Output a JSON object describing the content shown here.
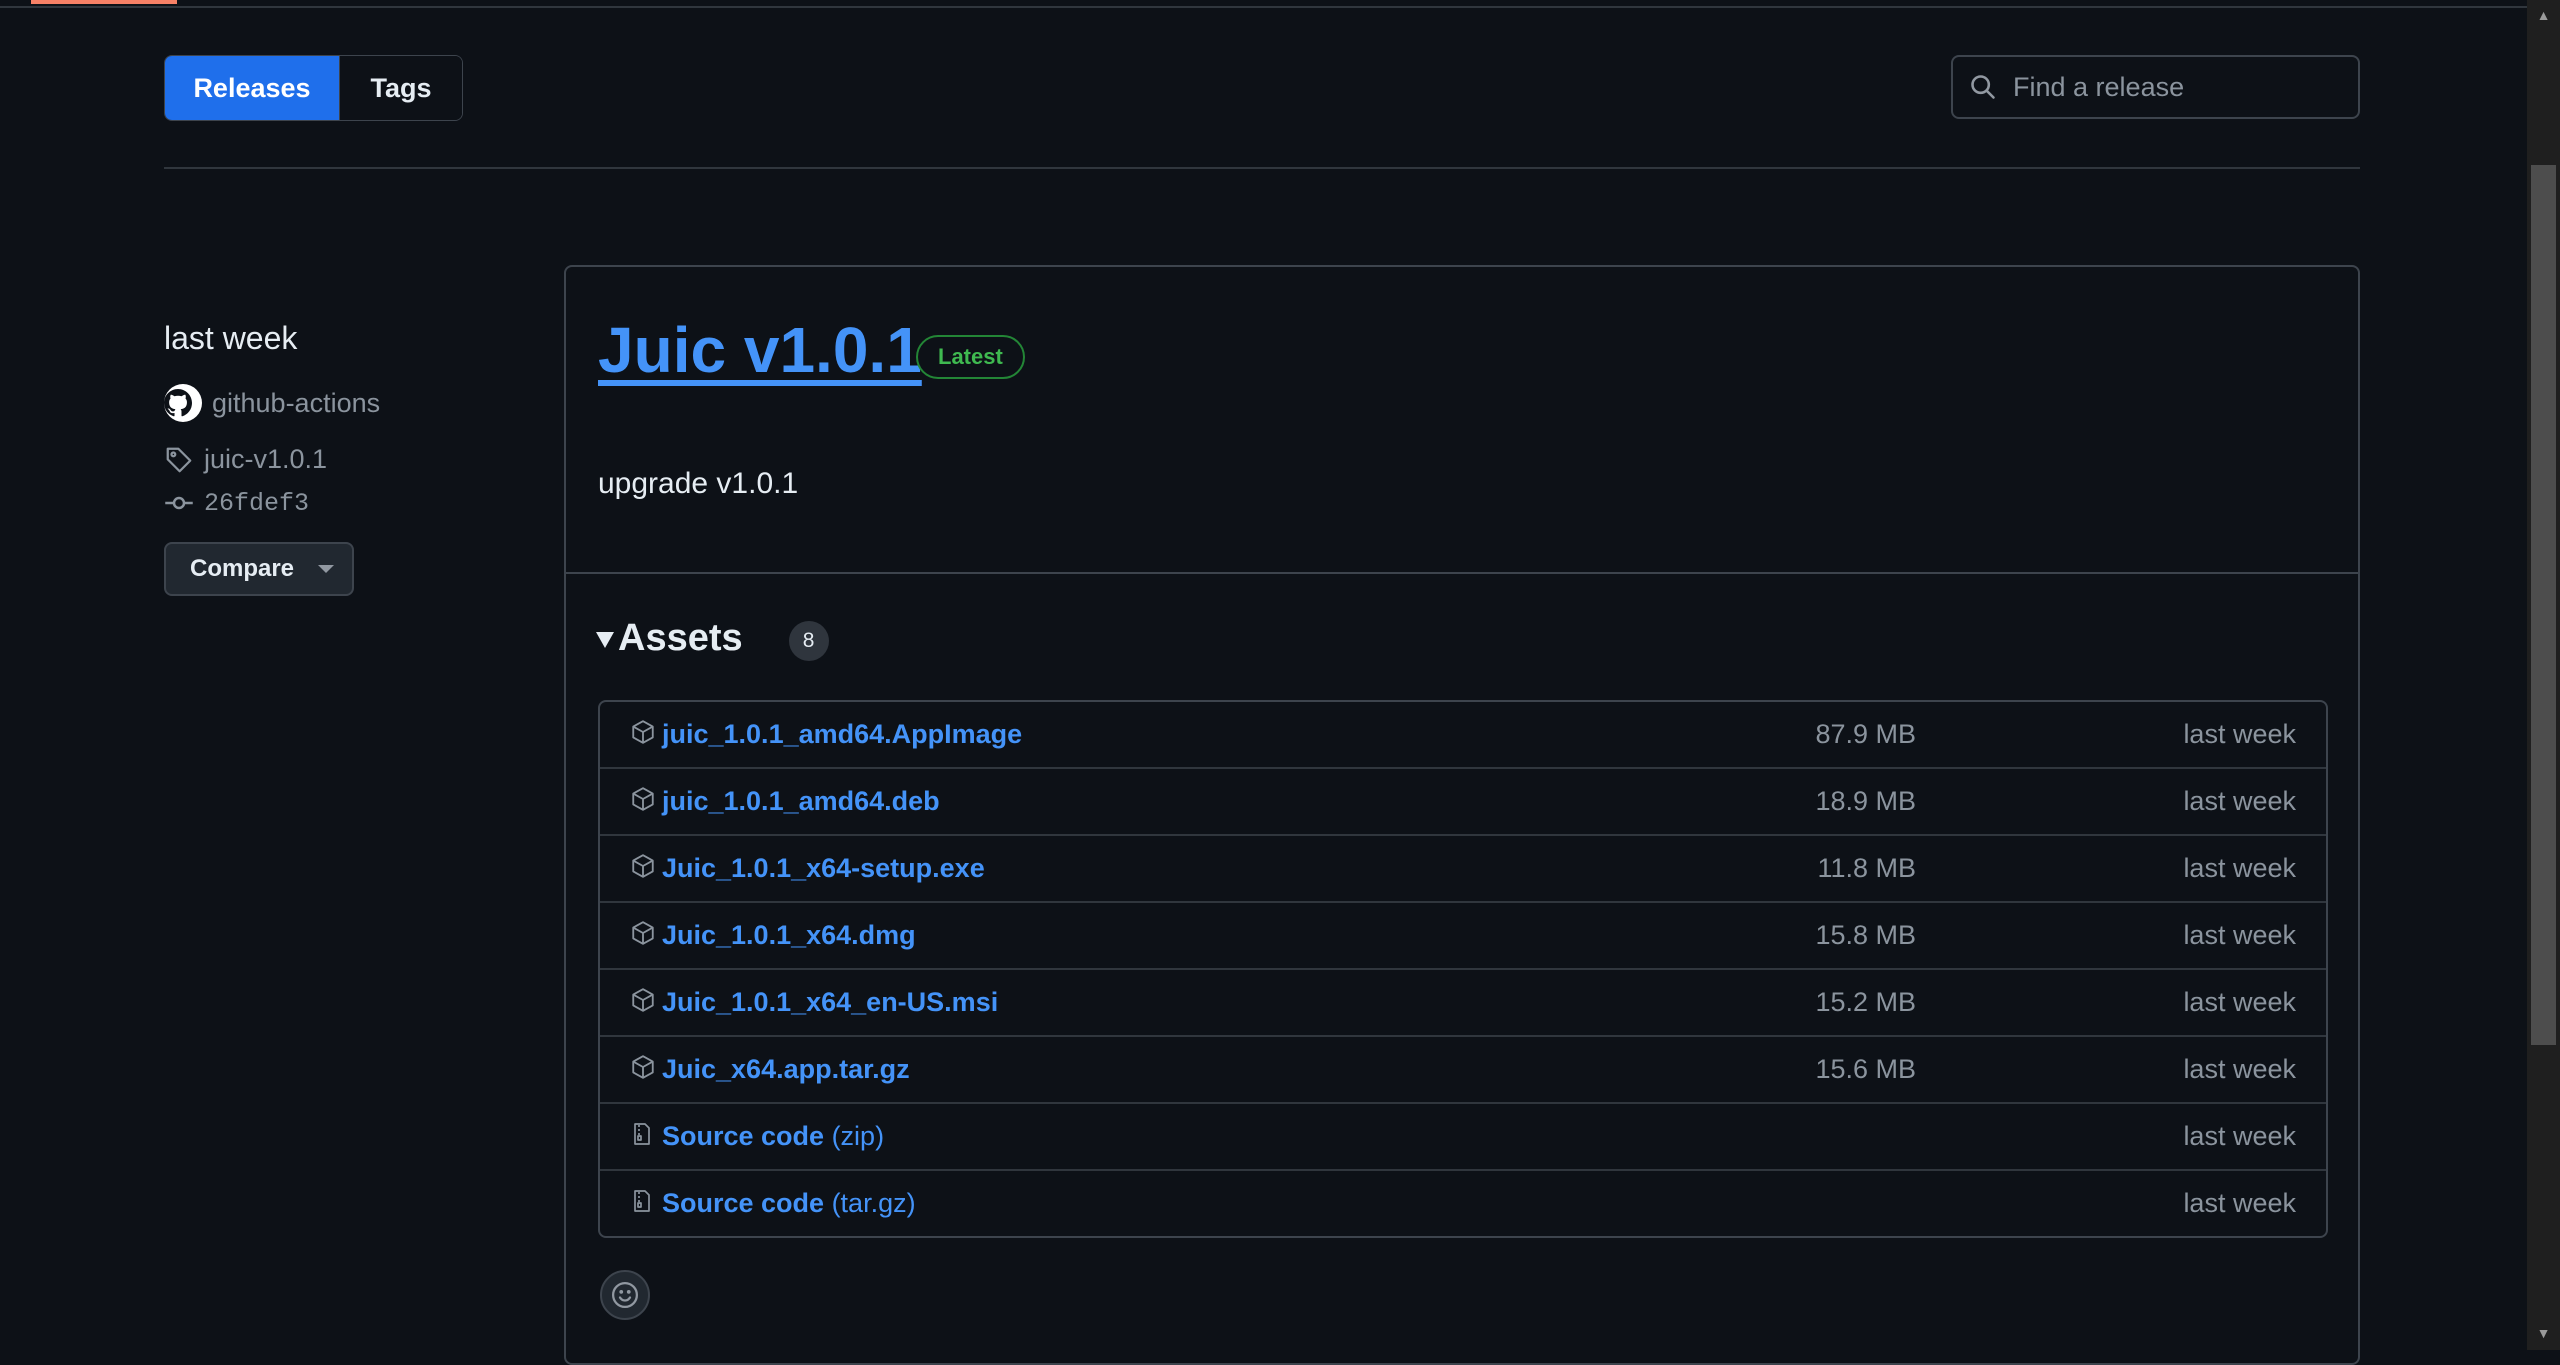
{
  "nav": {
    "releases_label": "Releases",
    "tags_label": "Tags"
  },
  "search": {
    "placeholder": "Find a release"
  },
  "release": {
    "date": "last week",
    "author": "github-actions",
    "tag": "juic-v1.0.1",
    "commit": "26fdef3",
    "compare_label": "Compare",
    "title": "Juic v1.0.1",
    "badge": "Latest",
    "body": "upgrade v1.0.1"
  },
  "assets": {
    "title": "Assets",
    "count": "8",
    "items": [
      {
        "name": "juic_1.0.1_amd64.AppImage",
        "suffix": "",
        "size": "87.9 MB",
        "when": "last week",
        "icon": "package-icon"
      },
      {
        "name": "juic_1.0.1_amd64.deb",
        "suffix": "",
        "size": "18.9 MB",
        "when": "last week",
        "icon": "package-icon"
      },
      {
        "name": "Juic_1.0.1_x64-setup.exe",
        "suffix": "",
        "size": "11.8 MB",
        "when": "last week",
        "icon": "package-icon"
      },
      {
        "name": "Juic_1.0.1_x64.dmg",
        "suffix": "",
        "size": "15.8 MB",
        "when": "last week",
        "icon": "package-icon"
      },
      {
        "name": "Juic_1.0.1_x64_en-US.msi",
        "suffix": "",
        "size": "15.2 MB",
        "when": "last week",
        "icon": "package-icon"
      },
      {
        "name": "Juic_x64.app.tar.gz",
        "suffix": "",
        "size": "15.6 MB",
        "when": "last week",
        "icon": "package-icon"
      },
      {
        "name": "Source code",
        "suffix": " (zip)",
        "size": "",
        "when": "last week",
        "icon": "file-zip-icon"
      },
      {
        "name": "Source code",
        "suffix": " (tar.gz)",
        "size": "",
        "when": "last week",
        "icon": "file-zip-icon"
      }
    ]
  },
  "colors": {
    "background": "#0d1117",
    "accent_blue": "#1f6feb",
    "link": "#4493f8",
    "latest_green": "#3fb950",
    "muted": "#8b949e",
    "border": "#3d444d"
  }
}
